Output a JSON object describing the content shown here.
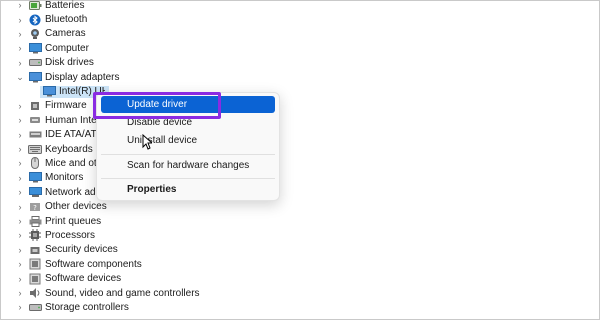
{
  "tree": {
    "top_items": [
      {
        "label": "Batteries",
        "icon": "battery-icon"
      },
      {
        "label": "Bluetooth",
        "icon": "bluetooth-icon"
      },
      {
        "label": "Cameras",
        "icon": "camera-icon"
      },
      {
        "label": "Computer",
        "icon": "computer-icon"
      },
      {
        "label": "Disk drives",
        "icon": "disk-drive-icon"
      }
    ],
    "display_adapters": {
      "label": "Display adapters",
      "icon": "display-adapter-icon"
    },
    "display_child": {
      "label": "Intel(R) UHD Graphics",
      "icon": "monitor-card-icon"
    },
    "bottom_items": [
      {
        "label": "Firmware",
        "icon": "firmware-icon"
      },
      {
        "label": "Human Interface Devices",
        "icon": "hid-icon"
      },
      {
        "label": "IDE ATA/ATAPI controllers",
        "icon": "ide-icon"
      },
      {
        "label": "Keyboards",
        "icon": "keyboard-icon"
      },
      {
        "label": "Mice and other pointing devices",
        "icon": "mouse-icon"
      },
      {
        "label": "Monitors",
        "icon": "monitor-icon"
      },
      {
        "label": "Network adapters",
        "icon": "network-icon"
      },
      {
        "label": "Other devices",
        "icon": "other-devices-icon"
      },
      {
        "label": "Print queues",
        "icon": "printer-icon"
      },
      {
        "label": "Processors",
        "icon": "processor-icon"
      },
      {
        "label": "Security devices",
        "icon": "security-icon"
      },
      {
        "label": "Software components",
        "icon": "software-component-icon"
      },
      {
        "label": "Software devices",
        "icon": "software-device-icon"
      },
      {
        "label": "Sound, video and game controllers",
        "icon": "sound-icon"
      },
      {
        "label": "Storage controllers",
        "icon": "storage-icon"
      }
    ]
  },
  "context_menu": {
    "items": [
      "Update driver",
      "Disable device",
      "Uninstall device",
      "Scan for hardware changes",
      "Properties"
    ]
  },
  "colors": {
    "menu_active": "#0b63d4",
    "highlight_box": "#8a2be2",
    "selected_row": "#cce4f7"
  }
}
